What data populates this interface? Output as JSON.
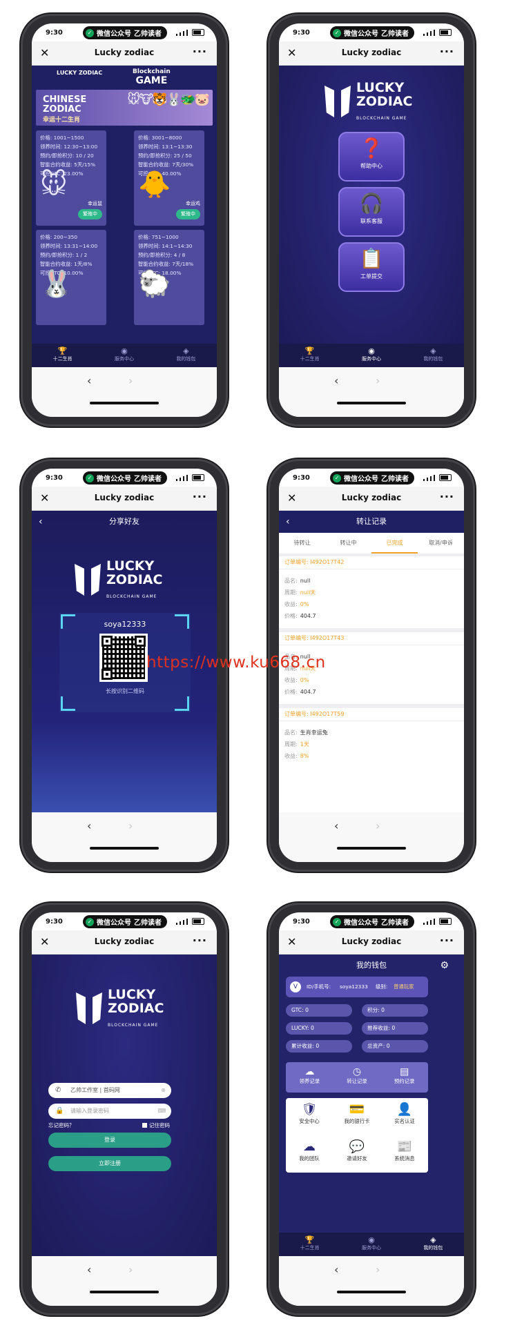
{
  "common": {
    "time": "9:30",
    "wechat_label": "微信公众号",
    "wechat_account": "乙帅读者",
    "app_title": "Lucky zodiac",
    "close_glyph": "✕",
    "more_glyph": "···",
    "back_glyph": "‹",
    "forward_glyph": "›"
  },
  "logo": {
    "line1": "LUCKY",
    "line2": "ZODIAC",
    "sub": "BLOCKCHAIN GAME"
  },
  "tabs": [
    "十二生肖",
    "服务中心",
    "我的钱包"
  ],
  "screen1": {
    "header_left": "LUCKY ZODIAC",
    "header_right_1": "Blockchain",
    "header_right_2": "GAME",
    "banner_line1": "CHINESE",
    "banner_line2": "ZODIAC",
    "banner_line3": "幸运十二生肖",
    "cards": [
      {
        "price": "价格:  1001~1500",
        "time": "领养时间:  12:30~13:00",
        "points": "预约/即抢积分:  10 / 20",
        "yield": "智能合约收益:  5天/15%",
        "gtc": "可挖GTC:  23.00%",
        "name": "幸运鼠",
        "status": "繁殖中"
      },
      {
        "price": "价格:  3001~8000",
        "time": "领养时间:  13:1~13:30",
        "points": "预约/即抢积分:  25 / 50",
        "yield": "智能合约收益:  7天/30%",
        "gtc": "可挖GTC:  40.00%",
        "name": "幸运鸡",
        "status": "繁殖中"
      },
      {
        "price": "价格:  200~350",
        "time": "领养时间:  13:31~14:00",
        "points": "预约/即抢积分:  1 / 2",
        "yield": "智能合约收益:  1天/8%",
        "gtc": "可挖GTC:  10.00%"
      },
      {
        "price": "价格:  751~1000",
        "time": "领养时间:  14:1~14:30",
        "points": "预约/即抢积分:  4 / 8",
        "yield": "智能合约收益:  7天/18%",
        "gtc": "可挖GTC:  18.00%"
      }
    ]
  },
  "screen2": {
    "menu": [
      {
        "icon": "❓",
        "label": "帮助中心"
      },
      {
        "icon": "🎧",
        "label": "联系客服"
      },
      {
        "icon": "📋",
        "label": "工单提交"
      }
    ]
  },
  "screen3": {
    "header": "分享好友",
    "username": "soya12333",
    "qr_hint": "长按识别二维码"
  },
  "screen4": {
    "header": "转让记录",
    "tabs": [
      "待转让",
      "转让中",
      "已完成",
      "取消/申诉"
    ],
    "selected_tab": "已完成",
    "orders": [
      {
        "title": "订单编号: I492O17T42",
        "name": "null",
        "period": "null天",
        "gain": "0%",
        "price": "404.7"
      },
      {
        "title": "订单编号: I492O17T43",
        "name": "null",
        "period": "null天",
        "gain": "0%",
        "price": "404.7"
      },
      {
        "title": "订单编号: I492O17T59",
        "name": "生肖幸运兔",
        "period": "1天",
        "gain": "8%"
      }
    ],
    "labels": {
      "name": "品名:",
      "period": "周期:",
      "gain": "收益:",
      "price": "价格:"
    }
  },
  "screen5": {
    "phone_value": "乙帅工作室 | 首码网",
    "password_placeholder": "请输入登录密码",
    "forgot": "忘记密码？",
    "remember": "记住密码",
    "login": "登录",
    "register": "立即注册"
  },
  "screen6": {
    "header": "我的钱包",
    "id_label": "ID/手机号:",
    "id_value": "soya12333",
    "level_label": "级别:",
    "level_value": "普通玩家",
    "stats": [
      "GTC: 0",
      "积分: 0",
      "LUCKY: 0",
      "推荐收益: 0",
      "累计收益: 0",
      "总资产: 0"
    ],
    "records": [
      {
        "icon": "☁",
        "label": "领养记录"
      },
      {
        "icon": "◷",
        "label": "转让记录"
      },
      {
        "icon": "▤",
        "label": "预约记录"
      }
    ],
    "grid": [
      {
        "icon": "🛡",
        "label": "安全中心"
      },
      {
        "icon": "💳",
        "label": "我的银行卡"
      },
      {
        "icon": "👤",
        "label": "实名认证"
      },
      {
        "icon": "☁",
        "label": "我的团队"
      },
      {
        "icon": "💬",
        "label": "邀请好友"
      },
      {
        "icon": "📰",
        "label": "系统消息"
      }
    ]
  },
  "watermark": "https://www.ku668.cn"
}
